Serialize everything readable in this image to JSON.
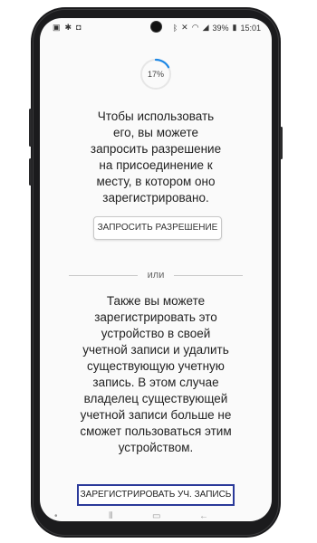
{
  "statusbar": {
    "left_icons": [
      "image-icon",
      "asterisk-icon",
      "bag-icon"
    ],
    "right_icons": [
      "bluetooth-icon",
      "mute-icon",
      "wifi-icon",
      "signal-icon",
      "battery-icon"
    ],
    "battery": "39%",
    "time": "15:01"
  },
  "progress": {
    "label": "17%",
    "value": 0.17,
    "color": "#1e88e5"
  },
  "section1": {
    "text": "Чтобы использовать\nего, вы можете\nзапросить разрешение\nна присоединение к\nместу, в котором оно\nзарегистрировано.",
    "button_label": "ЗАПРОСИТЬ РАЗРЕШЕНИЕ"
  },
  "divider": {
    "label": "или"
  },
  "section2": {
    "text": "Также вы можете\nзарегистрировать это\nустройство в своей\nучетной записи и удалить\nсуществующую учетную\nзапись. В этом случае\nвладелец существующей\nучетной записи больше не\nсможет пользоваться этим\nустройством.",
    "button_label": "ЗАРЕГИСТРИРОВАТЬ УЧ. ЗАПИСЬ",
    "highlight_color": "#2b3a9a"
  },
  "navbar": {
    "icons": [
      "dot-icon",
      "recent-apps-icon",
      "home-icon",
      "back-icon"
    ]
  }
}
